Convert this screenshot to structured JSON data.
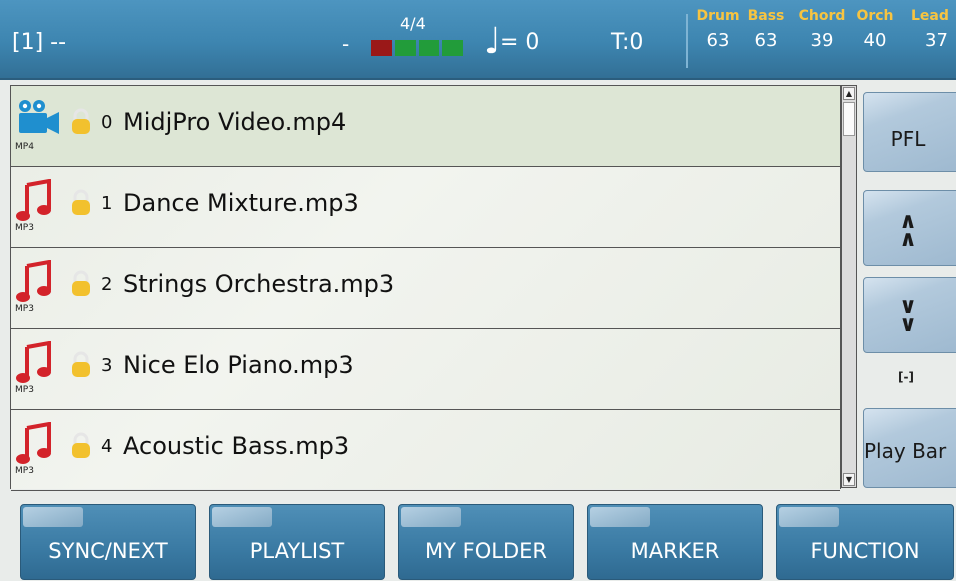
{
  "header": {
    "song": "[1] --",
    "dash": "-",
    "time_signature": "4/4",
    "beats": 4,
    "current_beat": 1,
    "note_icon": "quarter-note-icon",
    "tempo": "= 0",
    "transpose": "T:0",
    "channels": [
      {
        "name": "Drum",
        "value": "63"
      },
      {
        "name": "Bass",
        "value": "63"
      },
      {
        "name": "Chord",
        "value": "39"
      },
      {
        "name": "Orch",
        "value": "40"
      },
      {
        "name": "Lead",
        "value": "37"
      }
    ]
  },
  "files": [
    {
      "index": "0",
      "name": "MidjPro Video.mp4",
      "type": "MP4",
      "icon": "video-camera-icon"
    },
    {
      "index": "1",
      "name": "Dance Mixture.mp3",
      "type": "MP3",
      "icon": "music-note-icon"
    },
    {
      "index": "2",
      "name": "Strings Orchestra.mp3",
      "type": "MP3",
      "icon": "music-note-icon"
    },
    {
      "index": "3",
      "name": "Nice Elo Piano.mp3",
      "type": "MP3",
      "icon": "music-note-icon"
    },
    {
      "index": "4",
      "name": "Acoustic Bass.mp3",
      "type": "MP3",
      "icon": "music-note-icon"
    }
  ],
  "side": {
    "pfl": "PFL",
    "up": "^^",
    "down": "vv",
    "indicator": "[-]",
    "play_bar": "Play Bar"
  },
  "bottom": {
    "sync_next": "SYNC/NEXT",
    "playlist": "PLAYLIST",
    "my_folder": "MY FOLDER",
    "marker": "MARKER",
    "function": "FUNCTION"
  },
  "colors": {
    "header_blue": "#3d85b0",
    "channel_label": "#f7c441",
    "beat_on": "#9a1818",
    "beat_off": "#229c3a",
    "music_icon": "#d3232a",
    "video_icon": "#1f8fcf",
    "lock": "#f2c12e"
  }
}
